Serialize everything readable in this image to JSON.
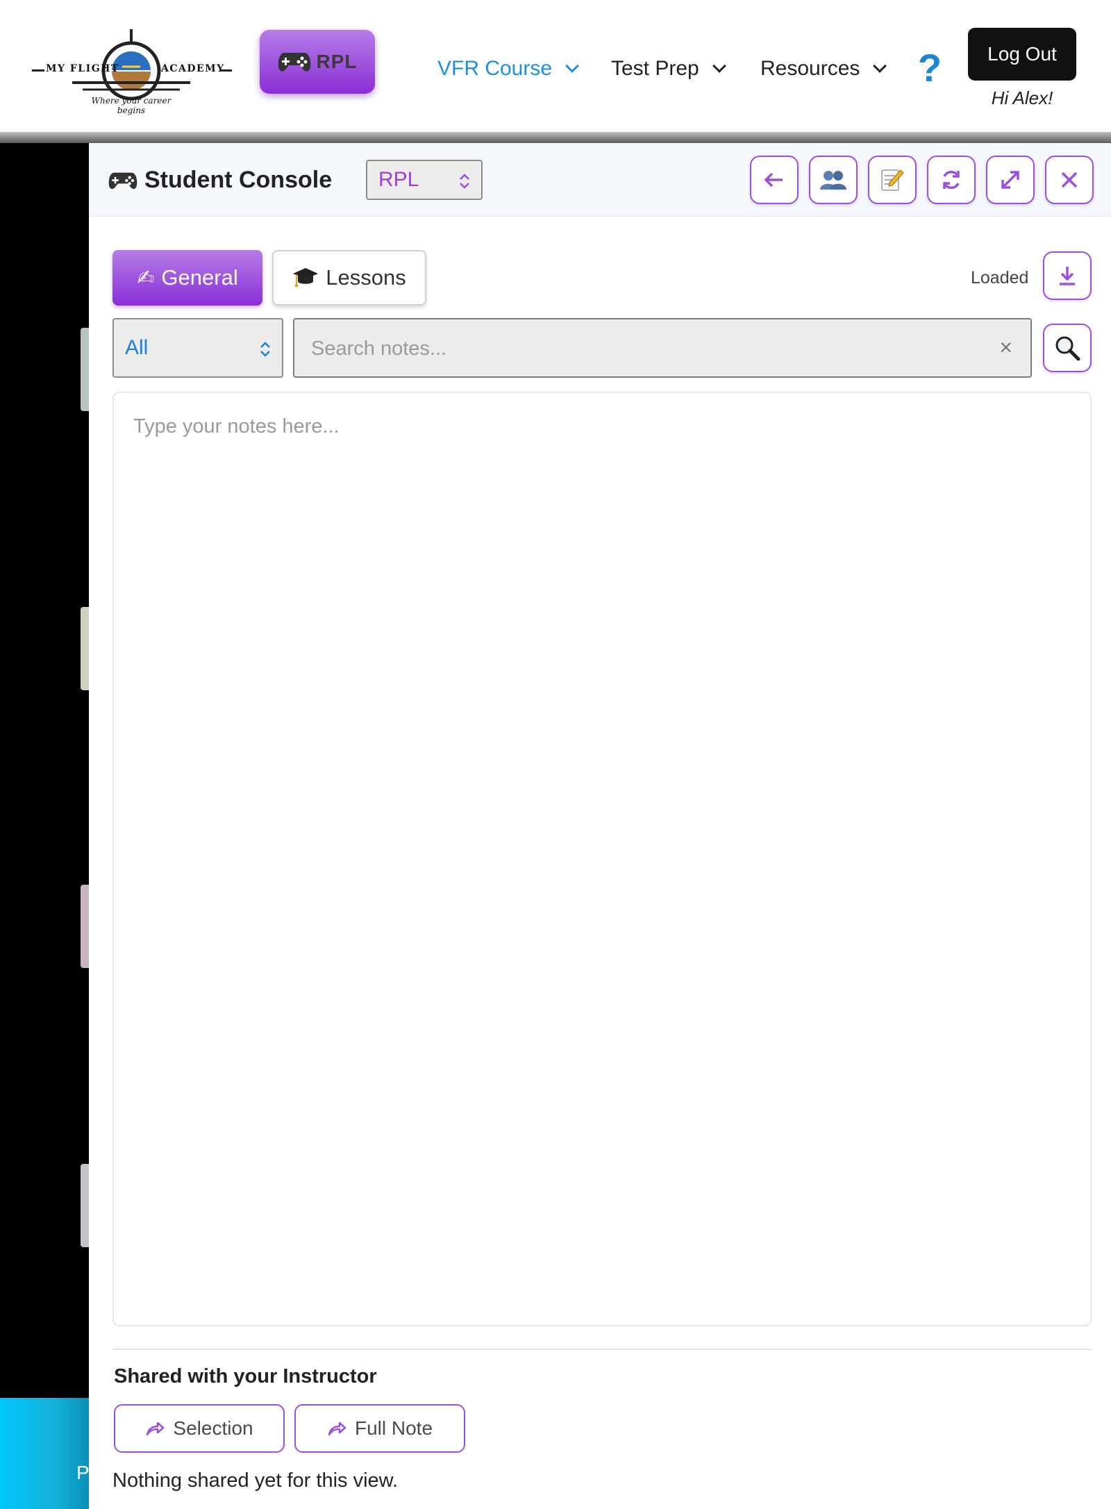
{
  "header": {
    "logo": {
      "left_text": "MY FLIGHT",
      "right_text": "ACADEMY",
      "tagline": "Where your career begins"
    },
    "rpl_button_label": "RPL",
    "nav": [
      {
        "label": "VFR Course",
        "active": true
      },
      {
        "label": "Test Prep",
        "active": false
      },
      {
        "label": "Resources",
        "active": false
      }
    ],
    "help_label": "?",
    "logout_label": "Log Out",
    "greeting": "Hi Alex!"
  },
  "console": {
    "title": "Student Console",
    "license_select": "RPL",
    "toolbar_icons": [
      "arrow-left-icon",
      "users-icon",
      "memo-icon",
      "refresh-icon",
      "expand-icon",
      "close-icon"
    ],
    "tabs": [
      {
        "label": "General",
        "active": true
      },
      {
        "label": "Lessons",
        "active": false
      }
    ],
    "status": "Loaded",
    "filter_select": "All",
    "search": {
      "placeholder": "Search notes...",
      "value": ""
    },
    "notes": {
      "placeholder": "Type your notes here...",
      "value": ""
    },
    "shared": {
      "title": "Shared with your Instructor",
      "selection_label": "Selection",
      "full_note_label": "Full Note",
      "empty_text": "Nothing shared yet for this view."
    }
  },
  "left_panel": {
    "clipped_text": "P"
  },
  "colors": {
    "accent_purple": "#9b4fe0",
    "nav_active": "#1a8fe3",
    "help_blue": "#1a86d4",
    "logout_bg": "#111111",
    "cyan_panel": "#00c6ff"
  }
}
